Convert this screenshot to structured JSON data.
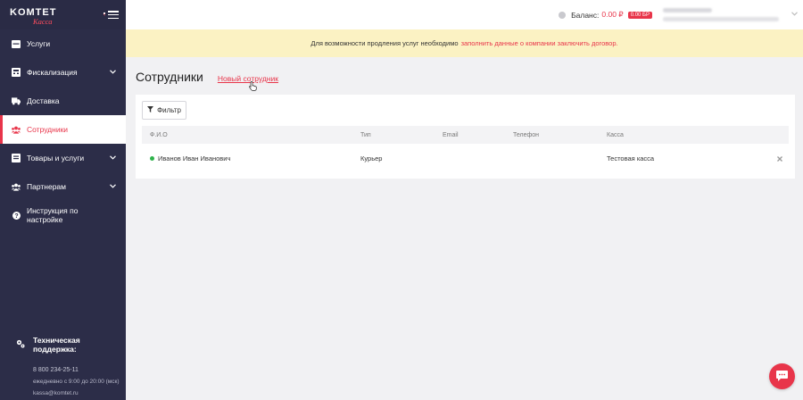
{
  "brand": {
    "logo_main": "KOMTET",
    "logo_sub": "Касса"
  },
  "sidebar": {
    "items": [
      {
        "label": "Услуги",
        "icon": "services-icon",
        "chevron": false,
        "active": false
      },
      {
        "label": "Фискализация",
        "icon": "fiscal-icon",
        "chevron": true,
        "active": false
      },
      {
        "label": "Доставка",
        "icon": "truck-icon",
        "chevron": false,
        "active": false
      },
      {
        "label": "Сотрудники",
        "icon": "users-icon",
        "chevron": false,
        "active": true
      },
      {
        "label": "Товары и услуги",
        "icon": "box-icon",
        "chevron": true,
        "active": false
      },
      {
        "label": "Партнерам",
        "icon": "partners-icon",
        "chevron": true,
        "active": false
      },
      {
        "label": "Инструкция по настройке",
        "icon": "question-icon",
        "chevron": false,
        "active": false
      }
    ],
    "support": {
      "title": "Техническая поддержка:",
      "phone": "8 800 234-25-11",
      "hours": "ежедневно с 9:00 до 20:00 (мск)",
      "email": "kassa@komtet.ru"
    }
  },
  "topbar": {
    "balance_label": "Баланс:",
    "balance_value": "0.00 ₽",
    "bonus_badge": "0.00 БР"
  },
  "banner": {
    "text": "Для возможности продления услуг необходимо",
    "link_text": "заполнить данные о компании заключить договор."
  },
  "page": {
    "title": "Сотрудники",
    "new_link": "Новый сотрудник"
  },
  "filter": {
    "label": "Фильтр"
  },
  "table": {
    "columns": [
      "Ф.И.О",
      "Тип",
      "Email",
      "Телефон",
      "Касса"
    ],
    "rows": [
      {
        "name": "Иванов Иван Иванович",
        "type": "Курьер",
        "email": "",
        "phone": "",
        "kassa": "Тестовая касса",
        "status_color": "#2fb34b"
      }
    ]
  },
  "colors": {
    "accent": "#e8354a",
    "sidebar_bg": "#2c2d48",
    "banner_bg": "#fbf2c3"
  }
}
